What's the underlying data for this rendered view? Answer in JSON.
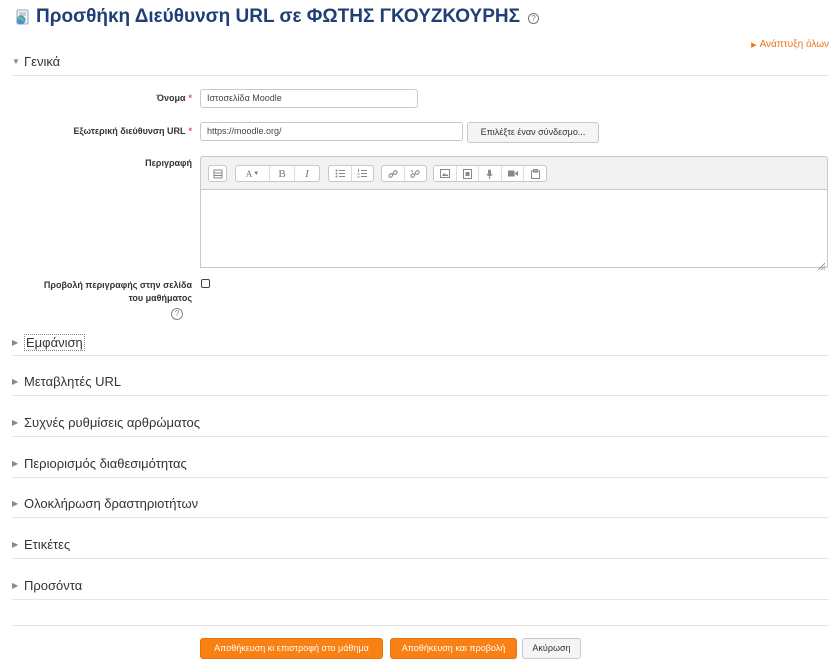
{
  "header": {
    "title": "Προσθήκη Διεύθυνση URL σε ΦΩΤΗΣ ΓΚΟΥΖΚΟΥΡΗΣ",
    "help_symbol": "?",
    "expand_all": "Ανάπτυξη όλων"
  },
  "general": {
    "section_title": "Γενικά",
    "name_label": "Όνομα",
    "name_value": "Ιστοσελίδα Moodle",
    "url_label": "Εξωτερική διεύθυνση URL",
    "url_value": "https://moodle.org/",
    "choose_link_button": "Επιλέξτε έναν σύνδεσμο...",
    "description_label": "Περιγραφή",
    "show_description_label_line1": "Προβολή περιγραφής στην σελίδα",
    "show_description_label_line2": "του μαθήματος",
    "required_marker": "*",
    "show_description_checked": false
  },
  "editor": {
    "toolbar_icons": [
      "toolbar-toggle-icon",
      "font-style-icon",
      "bold-icon",
      "italic-icon",
      "unordered-list-icon",
      "ordered-list-icon",
      "link-icon",
      "unlink-icon",
      "image-icon",
      "media-icon",
      "record-audio-icon",
      "record-video-icon",
      "manage-files-icon"
    ],
    "bold_glyph": "B",
    "italic_glyph": "I",
    "style_glyph": "A"
  },
  "sections": [
    "Εμφάνιση",
    "Μεταβλητές URL",
    "Συχνές ρυθμίσεις αρθρώματος",
    "Περιορισμός διαθεσιμότητας",
    "Ολοκλήρωση δραστηριοτήτων",
    "Ετικέτες",
    "Προσόντα"
  ],
  "footer": {
    "save_return": "Αποθήκευση κι επιστροφή στο μάθημα",
    "save_display": "Αποθήκευση και προβολή",
    "cancel": "Ακύρωση"
  },
  "colors": {
    "title": "#1f3f76",
    "accent_orange": "#f98012",
    "link_orange": "#e8731a",
    "required_red": "#d9534f"
  }
}
